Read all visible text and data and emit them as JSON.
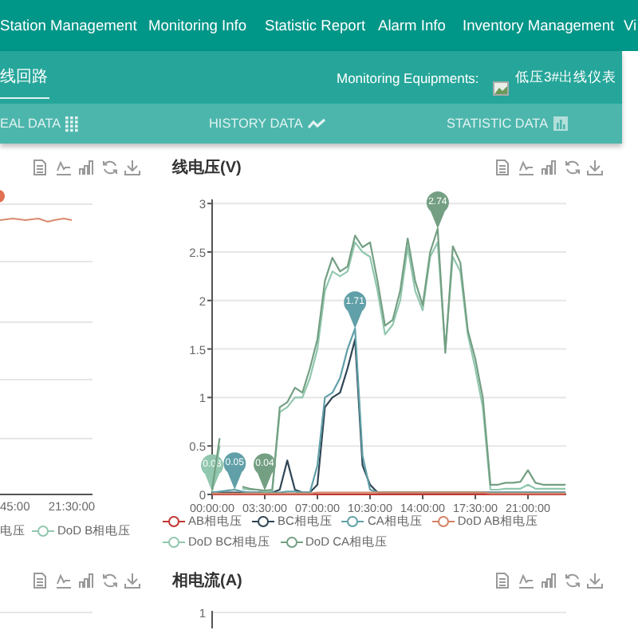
{
  "nav": {
    "items": [
      "Station Management",
      "Monitoring Info",
      "Statistic Report",
      "Alarm Info",
      "Inventory Management",
      "Vi"
    ]
  },
  "subheader": {
    "tabs": [
      {
        "label": "线回路",
        "selected": true
      }
    ],
    "equipment_label": "Monitoring Equipments:",
    "equipment_value": "低压3#出线仪表"
  },
  "data_tabs": [
    {
      "label": "EAL DATA",
      "kind": "grid"
    },
    {
      "label": "HISTORY DATA",
      "kind": "line"
    },
    {
      "label": "STATISTIC DATA",
      "kind": "bar"
    }
  ],
  "left_chart": {
    "xticks": [
      "45:00",
      "21:30:00"
    ],
    "legend": [
      {
        "label": "电压"
      },
      {
        "label": "DoD B相电压",
        "color": "#91c7ae"
      }
    ]
  },
  "voltage_chart": {
    "title": "线电压(V)",
    "chart_data": {
      "type": "line",
      "grid": true,
      "x": [
        0,
        0.5,
        1,
        1.5,
        2,
        2.5,
        3,
        3.5,
        4,
        4.5,
        5,
        5.5,
        6,
        6.5,
        7,
        7.5,
        8,
        8.5,
        9,
        9.5,
        10,
        10.5,
        11,
        11.5,
        12,
        12.5,
        13,
        13.5,
        14,
        14.5,
        15,
        15.5,
        16,
        16.5,
        17,
        17.5,
        18,
        18.5,
        19,
        19.5,
        20,
        20.5,
        21,
        21.5,
        22,
        22.5,
        23,
        23.5
      ],
      "series": [
        {
          "name": "AB相电压",
          "color": "#c23531",
          "values": [
            0,
            0,
            0,
            0,
            0,
            0,
            0,
            0,
            0,
            0,
            0,
            0,
            0,
            0,
            0,
            0,
            0,
            0,
            0,
            0,
            0,
            0,
            0,
            0,
            0,
            0,
            0,
            0,
            0,
            0,
            0,
            0,
            0,
            0,
            0,
            0,
            0,
            0,
            0,
            0,
            0,
            0,
            0,
            0,
            0,
            0,
            0,
            0
          ]
        },
        {
          "name": "BC相电压",
          "color": "#2f4554",
          "values": [
            0.02,
            0.02,
            0.02,
            0.02,
            0.02,
            0.02,
            0.02,
            0.02,
            0.02,
            0.05,
            0.35,
            0.05,
            0.02,
            0.02,
            0.1,
            0.9,
            1.0,
            1.05,
            1.3,
            1.6,
            0.3,
            0.1,
            0.02,
            0.02,
            0.02,
            0.02,
            0.02,
            0.02,
            0.02,
            0.02,
            0.02,
            0.02,
            0.02,
            0.02,
            0.02,
            0.02,
            0.02,
            0.02,
            0.02,
            0.02,
            0.02,
            0.02,
            0.02,
            0.02,
            0.02,
            0.02,
            0.02,
            0.02
          ]
        },
        {
          "name": "CA相电压",
          "color": "#61a0a8",
          "values": [
            0.02,
            0.03,
            0.04,
            0.05,
            0.03,
            0.02,
            0.02,
            0.02,
            0.02,
            0.02,
            0.03,
            0.03,
            0.02,
            0.02,
            0.3,
            1.0,
            1.05,
            1.2,
            1.5,
            1.71,
            0.4,
            0.05,
            0.02,
            0.02,
            0.02,
            0.02,
            0.02,
            0.02,
            0.02,
            0.02,
            0.02,
            0.02,
            0.02,
            0.02,
            0.02,
            0.02,
            0.02,
            0.02,
            0.02,
            0.02,
            0.02,
            0.02,
            0.02,
            0.02,
            0.02,
            0.02,
            0.02,
            0.02
          ]
        },
        {
          "name": "DoD AB相电压",
          "color": "#d48265",
          "values": [
            0.01,
            0.01,
            0.01,
            0.01,
            0.01,
            0.01,
            0.01,
            0.01,
            0.01,
            0.01,
            0.01,
            0.01,
            0.01,
            0.01,
            0.02,
            0.02,
            0.02,
            0.02,
            0.02,
            0.02,
            0.02,
            0.02,
            0.02,
            0.02,
            0.02,
            0.02,
            0.02,
            0.02,
            0.02,
            0.02,
            0.02,
            0.02,
            0.02,
            0.02,
            0.02,
            0.02,
            0.02,
            0.01,
            0.01,
            0.01,
            0.01,
            0.01,
            0.01,
            0.01,
            0.01,
            0.01,
            0.01,
            0.01
          ]
        },
        {
          "name": "DoD BC相电压",
          "color": "#91c7ae",
          "values": [
            0.03,
            0.5,
            null,
            null,
            0.06,
            0.05,
            0.05,
            0.03,
            0.04,
            0.85,
            0.9,
            1.0,
            1.0,
            1.2,
            1.5,
            2.1,
            2.3,
            2.25,
            2.3,
            2.6,
            2.5,
            2.45,
            2.1,
            1.65,
            1.75,
            2.0,
            2.55,
            2.1,
            1.9,
            2.45,
            2.6,
            1.5,
            2.45,
            2.3,
            1.65,
            1.3,
            0.9,
            0.05,
            0.05,
            0.06,
            0.06,
            0.06,
            0.1,
            0.06,
            0.06,
            0.06,
            0.06,
            0.06
          ]
        },
        {
          "name": "DoD CA相电压",
          "color": "#749f83",
          "values": [
            0.05,
            0.58,
            null,
            null,
            0.08,
            0.06,
            0.05,
            0.04,
            0.05,
            0.9,
            0.95,
            1.1,
            1.05,
            1.3,
            1.6,
            2.2,
            2.44,
            2.3,
            2.35,
            2.67,
            2.55,
            2.6,
            2.2,
            1.74,
            1.8,
            2.1,
            2.64,
            2.2,
            1.95,
            2.5,
            2.74,
            1.46,
            2.56,
            2.39,
            1.69,
            1.4,
            1.0,
            0.1,
            0.1,
            0.12,
            0.12,
            0.13,
            0.25,
            0.12,
            0.1,
            0.1,
            0.1,
            0.1
          ]
        }
      ],
      "xlim": [
        0,
        23.5
      ],
      "ylim": [
        0,
        3
      ],
      "yticks": [
        0,
        0.5,
        1,
        1.5,
        2,
        2.5,
        3
      ],
      "xticks": [
        {
          "value": 0,
          "label": "00:00:00"
        },
        {
          "value": 3.5,
          "label": "03:30:00"
        },
        {
          "value": 7,
          "label": "07:00:00"
        },
        {
          "value": 10.5,
          "label": "10:30:00"
        },
        {
          "value": 14,
          "label": "14:00:00"
        },
        {
          "value": 17.5,
          "label": "17:30:00"
        },
        {
          "value": 21,
          "label": "21:00:00"
        }
      ],
      "annotations": [
        {
          "x": 0,
          "y": 0.03,
          "text": "0.03"
        },
        {
          "x": 1.5,
          "y": 0.05,
          "text": "0.05"
        },
        {
          "x": 3.5,
          "y": 0.04,
          "text": "0.04"
        },
        {
          "x": 9.5,
          "y": 1.71,
          "text": "1.71"
        },
        {
          "x": 15,
          "y": 2.74,
          "text": "2.74"
        }
      ]
    }
  },
  "current_chart": {
    "title": "相电流(A)",
    "yticks": [
      "1"
    ]
  }
}
